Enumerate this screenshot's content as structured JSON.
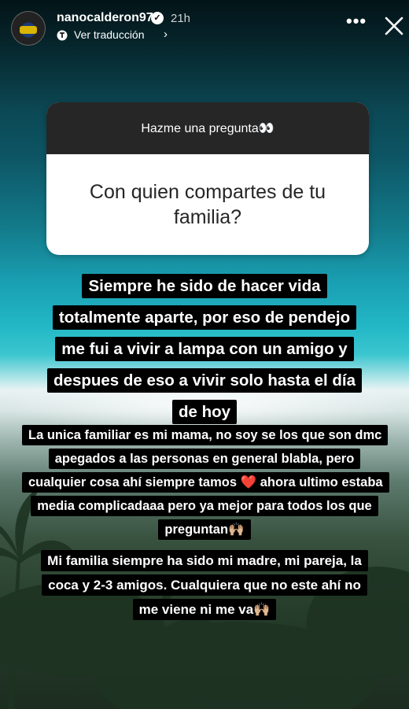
{
  "header": {
    "username": "nanocalderon97",
    "verified_badge": "verified-icon",
    "timestamp": "21h",
    "translate_label": "Ver traducción",
    "more_icon": "more-horizontal-icon",
    "close_icon": "close-icon"
  },
  "question_sticker": {
    "prompt": "Hazme una pregunta👀",
    "question": "Con quien compartes de tu familia?"
  },
  "answers": [
    "Siempre he sido de hacer vida totalmente aparte, por eso de pendejo me fui a vivir a lampa con un amigo y despues de eso a vivir solo hasta el día de hoy",
    "La unica familiar es mi mama, no soy se los que son dmc apegados a las personas en general blabla, pero cualquier cosa ahí siempre tamos ❤️ ahora ultimo estaba media complicadaaa pero ya mejor para todos los que preguntan🙌🏼",
    "Mi familia siempre ha sido mi madre, mi pareja, la coca y 2-3 amigos. Cualquiera que no este ahí no me viene ni me va🙌🏼"
  ],
  "colors": {
    "sticker_header": "#262626",
    "sticker_body": "#ffffff",
    "text_highlight": "#000000",
    "ocean": "#1aa0b3"
  }
}
